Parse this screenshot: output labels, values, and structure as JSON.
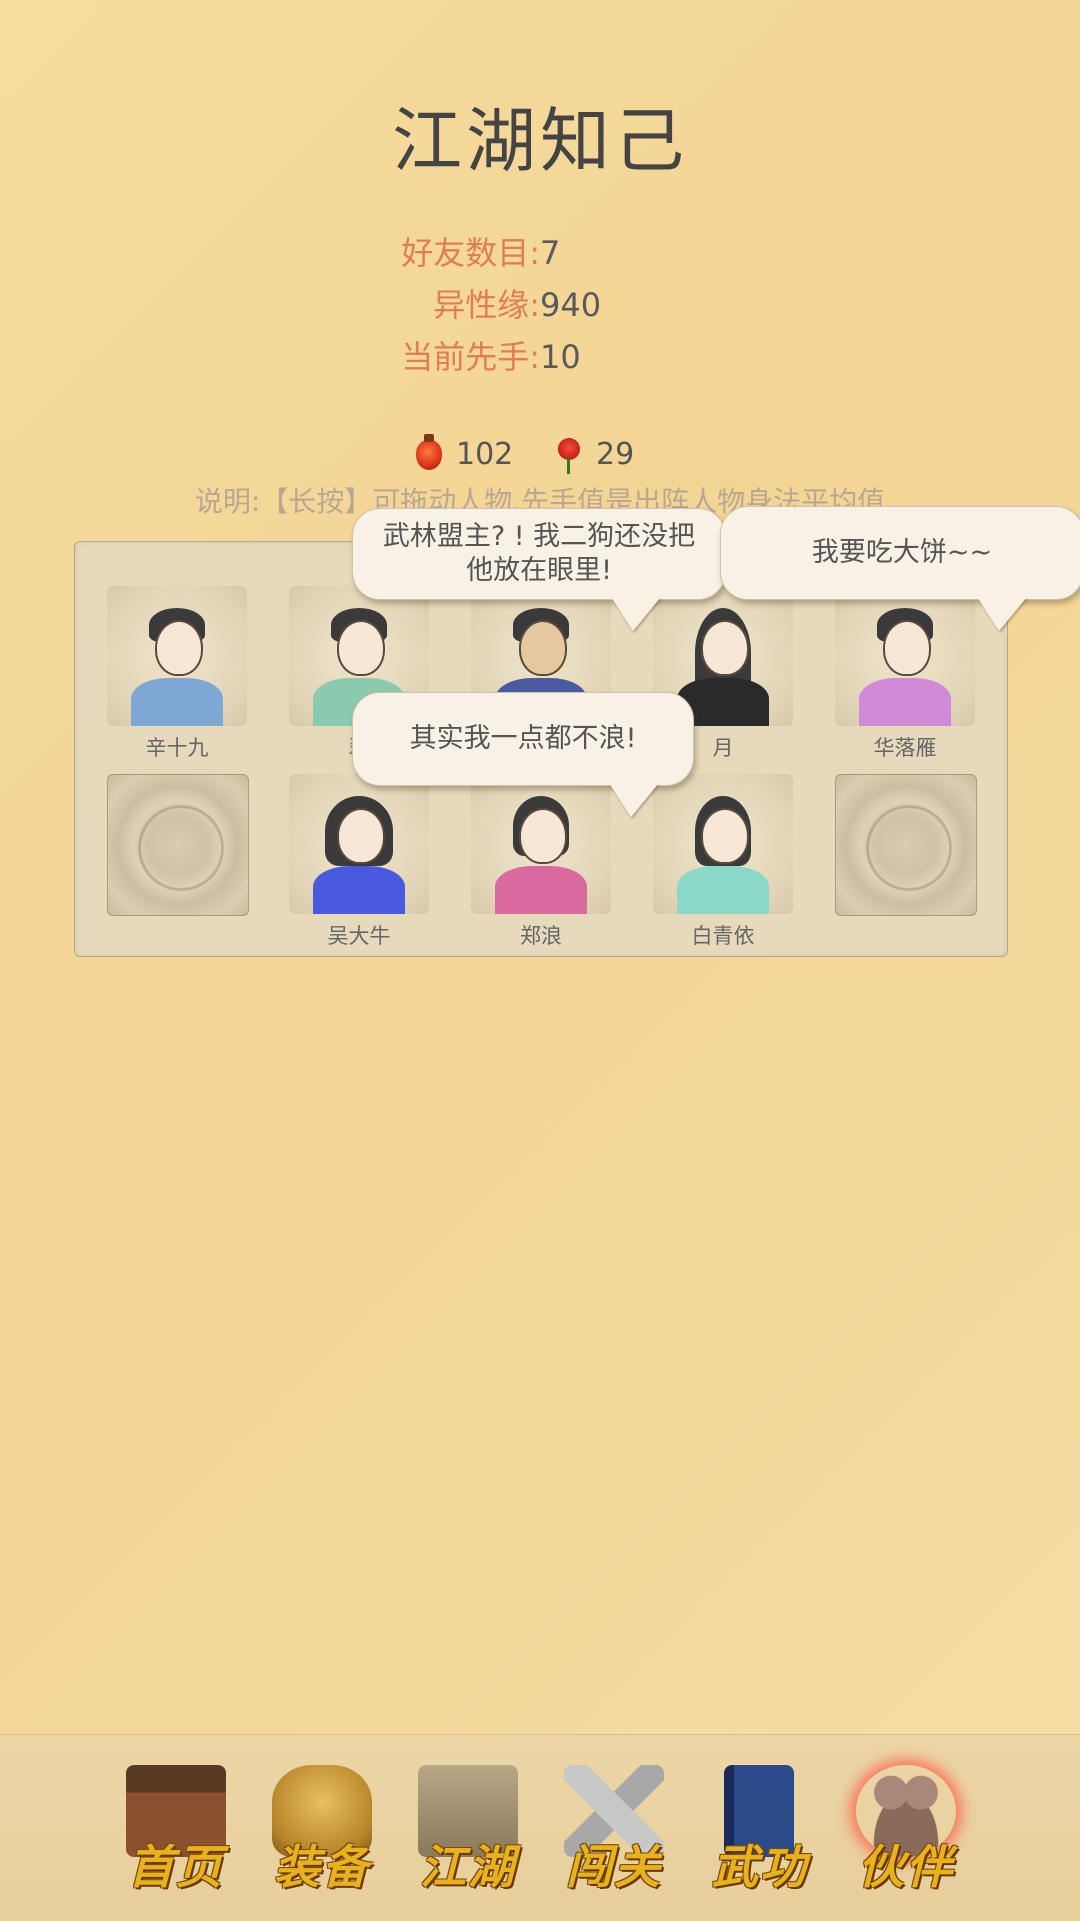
{
  "header": {
    "title": "江湖知己"
  },
  "stats": [
    {
      "label": "好友数目:",
      "value": "7"
    },
    {
      "label": "异性缘:",
      "value": "940"
    },
    {
      "label": "当前先手:",
      "value": "10"
    }
  ],
  "currency": {
    "gourd": {
      "icon": "gourd-icon",
      "value": "102"
    },
    "rose": {
      "icon": "rose-icon",
      "value": "29"
    }
  },
  "description": "说明:【长按】可拖动人物,先手值是出阵人物身法平均值",
  "characters": [
    {
      "name": "辛十九",
      "robe": "#7fa7d6"
    },
    {
      "name": "翠",
      "robe": "#8ccab0"
    },
    {
      "name": "",
      "robe": "#4a5aa0"
    },
    {
      "name": "月",
      "robe": "#2a2a2a"
    },
    {
      "name": "华落雁",
      "robe": "#d08ad8"
    },
    {
      "name": "",
      "empty": true
    },
    {
      "name": "吴大牛",
      "robe": "#4a5ae0"
    },
    {
      "name": "郑浪",
      "robe": "#d86aa0"
    },
    {
      "name": "白青依",
      "robe": "#8ad8c8"
    },
    {
      "name": "",
      "empty": true
    }
  ],
  "bubbles": {
    "b1": "武林盟主? ! 我二狗还没把 他放在眼里!",
    "b2": "我要吃大饼~~",
    "b3": "其实我一点都不浪!"
  },
  "nav": [
    {
      "label": "首页",
      "icon": "house-icon",
      "color": "#8a5030"
    },
    {
      "label": "装备",
      "icon": "armor-icon",
      "color": "#c8982a"
    },
    {
      "label": "江湖",
      "icon": "scroll-map-icon",
      "color": "#9a8a6a"
    },
    {
      "label": "闯关",
      "icon": "crossed-swords-icon",
      "color": "#b8b8b8"
    },
    {
      "label": "武功",
      "icon": "book-icon",
      "color": "#2a4a8a"
    },
    {
      "label": "伙伴",
      "icon": "partners-icon",
      "color": "#8a6a5a",
      "active": true
    }
  ]
}
